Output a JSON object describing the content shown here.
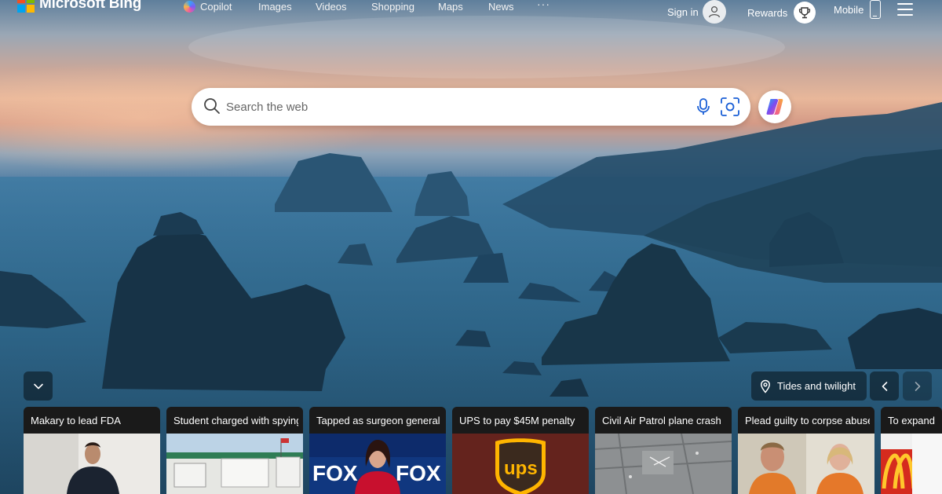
{
  "brand": {
    "name": "Microsoft Bing"
  },
  "nav": {
    "items": [
      {
        "label": "Copilot",
        "icon": "copilot-icon"
      },
      {
        "label": "Images"
      },
      {
        "label": "Videos"
      },
      {
        "label": "Shopping"
      },
      {
        "label": "Maps"
      },
      {
        "label": "News"
      }
    ],
    "more_label": "···"
  },
  "header_right": {
    "signin_label": "Sign in",
    "rewards_label": "Rewards",
    "mobile_label": "Mobile"
  },
  "search": {
    "placeholder": "Search the web",
    "value": ""
  },
  "image_of_day": {
    "location_label": "Tides and twilight"
  },
  "news": [
    {
      "title": "Makary to lead FDA"
    },
    {
      "title": "Student charged with spying"
    },
    {
      "title": "Tapped as surgeon general"
    },
    {
      "title": "UPS to pay $45M penalty"
    },
    {
      "title": "Civil Air Patrol plane crash"
    },
    {
      "title": "Plead guilty to corpse abuse"
    },
    {
      "title": "To expand"
    }
  ],
  "colors": {
    "accent": "#0f6cbd",
    "card_bg": "#1a1a1a"
  }
}
